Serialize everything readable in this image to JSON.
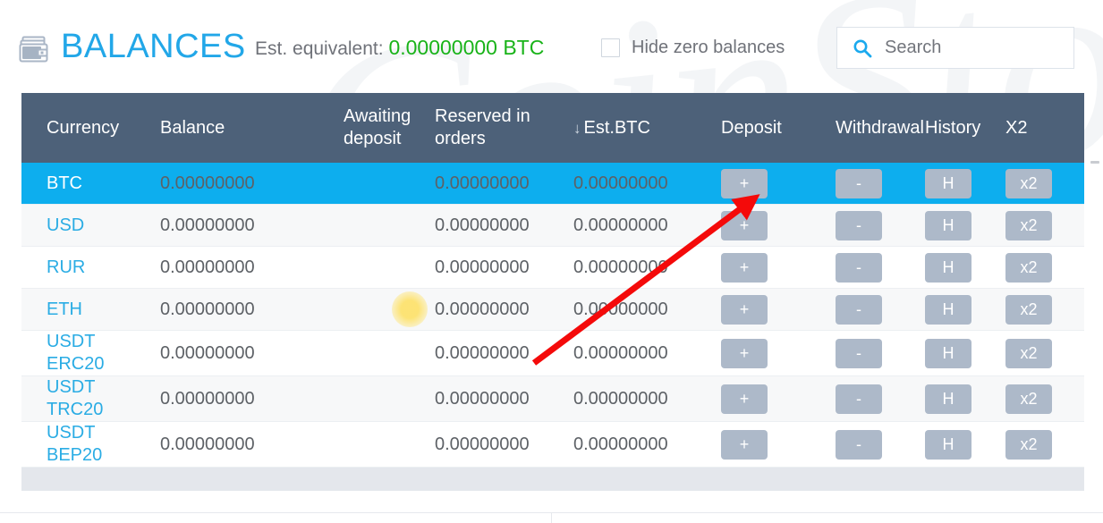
{
  "header": {
    "wallet_icon": "wallet-icon",
    "title": "BALANCES",
    "est_label": "Est. equivalent:",
    "est_value": "0.00000000 BTC",
    "hide_zero_label": "Hide zero balances",
    "hide_zero_checked": false,
    "search_icon": "search-icon",
    "search_value": "",
    "search_placeholder": "Search"
  },
  "colors": {
    "accent_blue": "#22a7e8",
    "row_selected": "#0daeee",
    "header_bg": "#4d6179",
    "button_bg": "#adb9c9",
    "est_green": "#19b319",
    "arrow_red": "#f40a0a"
  },
  "table": {
    "columns": [
      "Currency",
      "Balance",
      "Awaiting deposit",
      "Reserved in orders",
      "Est.BTC",
      "Deposit",
      "Withdrawal",
      "History",
      "X2"
    ],
    "sort_column": "Est.BTC",
    "sort_indicator": "↓",
    "buttons": {
      "deposit": "+",
      "withdrawal": "-",
      "history": "H",
      "x2": "x2"
    },
    "rows": [
      {
        "currency": "BTC",
        "currency_line2": "",
        "balance": "0.00000000",
        "awaiting_deposit": "",
        "reserved_in_orders": "0.00000000",
        "est_btc": "0.00000000",
        "selected": true
      },
      {
        "currency": "USD",
        "currency_line2": "",
        "balance": "0.00000000",
        "awaiting_deposit": "",
        "reserved_in_orders": "0.00000000",
        "est_btc": "0.00000000",
        "selected": false
      },
      {
        "currency": "RUR",
        "currency_line2": "",
        "balance": "0.00000000",
        "awaiting_deposit": "",
        "reserved_in_orders": "0.00000000",
        "est_btc": "0.00000000",
        "selected": false
      },
      {
        "currency": "ETH",
        "currency_line2": "",
        "balance": "0.00000000",
        "awaiting_deposit": "",
        "reserved_in_orders": "0.00000000",
        "est_btc": "0.00000000",
        "selected": false
      },
      {
        "currency": "USDT",
        "currency_line2": "ERC20",
        "balance": "0.00000000",
        "awaiting_deposit": "",
        "reserved_in_orders": "0.00000000",
        "est_btc": "0.00000000",
        "selected": false
      },
      {
        "currency": "USDT",
        "currency_line2": "TRC20",
        "balance": "0.00000000",
        "awaiting_deposit": "",
        "reserved_in_orders": "0.00000000",
        "est_btc": "0.00000000",
        "selected": false
      },
      {
        "currency": "USDT",
        "currency_line2": "BEP20",
        "balance": "0.00000000",
        "awaiting_deposit": "",
        "reserved_in_orders": "0.00000000",
        "est_btc": "0.00000000",
        "selected": false
      }
    ]
  },
  "annotations": {
    "arrow_target": "deposit-plus-button-btc-row",
    "highlight_blob": "yellow-cursor-highlight"
  },
  "watermark": {
    "text": "CoinStore"
  }
}
